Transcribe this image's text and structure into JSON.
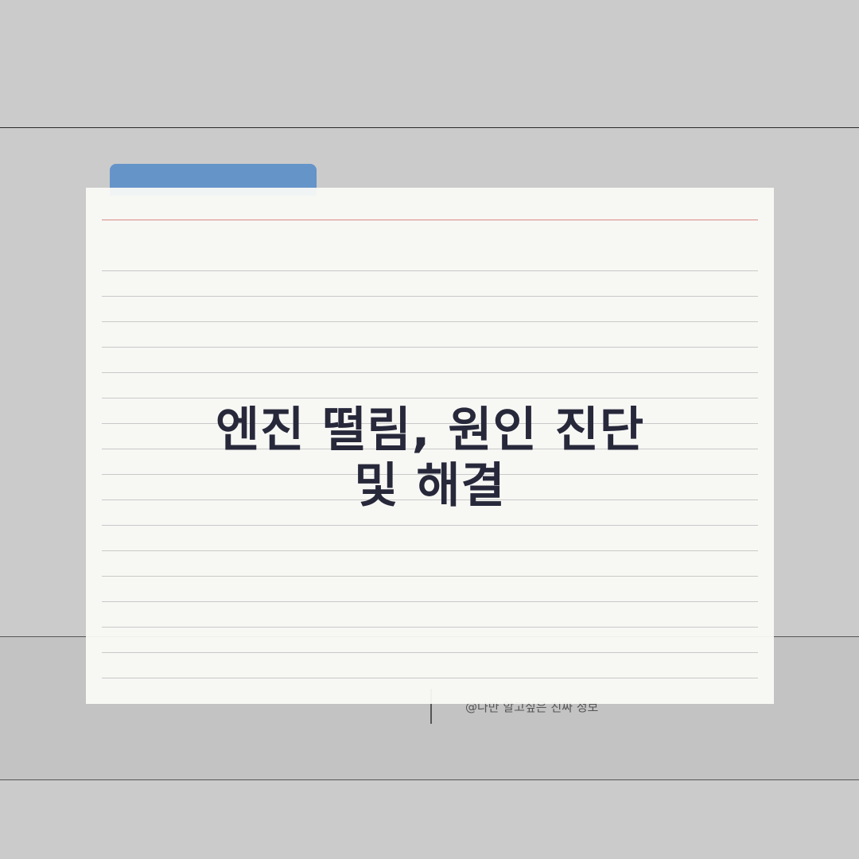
{
  "card": {
    "title_line1": "엔진 떨림, 원인 진단",
    "title_line2": "및 해결"
  },
  "footer": {
    "credit": "@나만 알고싶은 진짜 정보"
  },
  "colors": {
    "background": "#cbcbcb",
    "tab": "#6594c9",
    "card": "#fafaf6",
    "margin_line": "#d98a86",
    "title_text": "#27283a"
  }
}
